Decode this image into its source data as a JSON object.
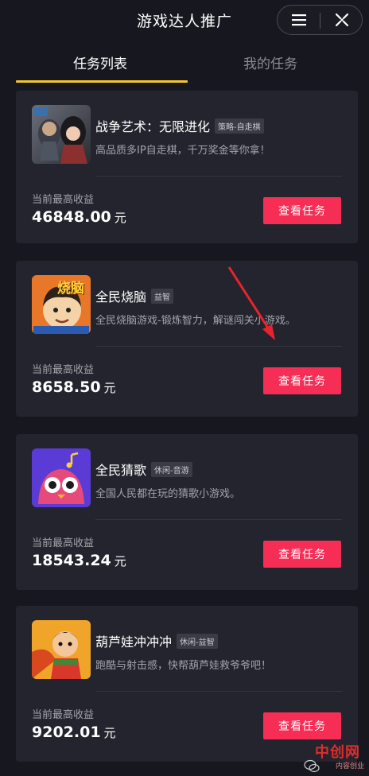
{
  "header": {
    "title": "游戏达人推广"
  },
  "tabs": [
    {
      "label": "任务列表",
      "active": true
    },
    {
      "label": "我的任务",
      "active": false
    }
  ],
  "earnings_label": "当前最高收益",
  "currency_unit": "元",
  "view_button_label": "查看任务",
  "games": [
    {
      "name": "战争艺术：无限进化",
      "tag": "策略-自走棋",
      "description": "高品质多IP自走棋，千万奖金等你拿！",
      "earnings": "46848.00"
    },
    {
      "name": "全民烧脑",
      "tag": "益智",
      "description": "全民烧脑游戏-锻炼智力，解谜闯关小游戏。",
      "earnings": "8658.50",
      "icon_text": "烧脑"
    },
    {
      "name": "全民猜歌",
      "tag": "休闲-音游",
      "description": "全国人民都在玩的猜歌小游戏。",
      "earnings": "18543.24"
    },
    {
      "name": "葫芦娃冲冲冲",
      "tag": "休闲-益智",
      "description": "跑酷与射击感，快帮葫芦娃救爷爷吧！",
      "earnings": "9202.01"
    }
  ],
  "watermark": {
    "text": "中创网",
    "sub": "内容创业"
  },
  "colors": {
    "background": "#17181f",
    "card": "#23242d",
    "accent": "#f62d55",
    "tab_underline": "#f3c62b"
  }
}
